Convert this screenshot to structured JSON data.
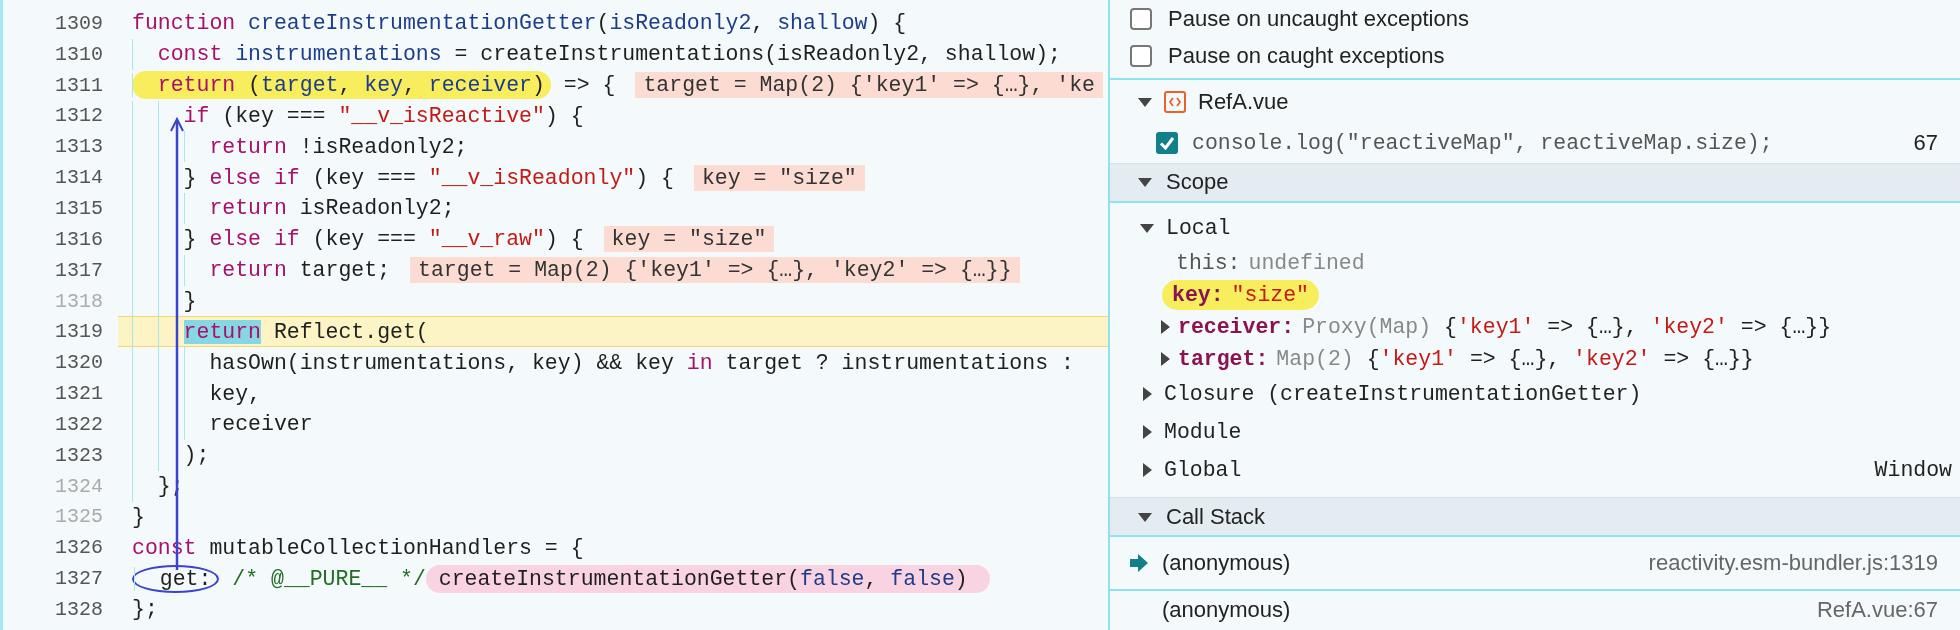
{
  "code_editor": {
    "lines": [
      {
        "number": "1309",
        "faded": false,
        "current": false,
        "tokens": [
          {
            "text": "function",
            "kind": "k"
          },
          {
            "text": " createInstrumentationGetter",
            "kind": "d"
          },
          {
            "text": "(",
            "kind": "p"
          },
          {
            "text": "isReadonly2",
            "kind": "d"
          },
          {
            "text": ", ",
            "kind": "p"
          },
          {
            "text": "shallow",
            "kind": "d"
          },
          {
            "text": ") {",
            "kind": "p"
          }
        ]
      },
      {
        "number": "1310",
        "faded": false,
        "current": false,
        "tokens": [
          {
            "text": "  const",
            "kind": "k"
          },
          {
            "text": " instrumentations",
            "kind": "d"
          },
          {
            "text": " = createInstrumentations(isReadonly2, shallow);",
            "kind": "p"
          }
        ]
      },
      {
        "number": "1311",
        "faded": false,
        "current": false,
        "tokens": [
          {
            "kind": "marker",
            "tokens": [
              {
                "text": "  return",
                "kind": "k"
              },
              {
                "text": " (",
                "kind": "p"
              },
              {
                "text": "target",
                "kind": "d"
              },
              {
                "text": ", ",
                "kind": "p"
              },
              {
                "text": "key",
                "kind": "d"
              },
              {
                "text": ", ",
                "kind": "p"
              },
              {
                "text": "receiver",
                "kind": "d"
              },
              {
                "text": ")",
                "kind": "p"
              }
            ]
          },
          {
            "text": " => {",
            "kind": "p"
          }
        ],
        "inline_values": [
          "target = Map(2) {'key1' => {…}, 'ke"
        ]
      },
      {
        "number": "1312",
        "faded": false,
        "current": false,
        "tokens": [
          {
            "text": "    if",
            "kind": "k"
          },
          {
            "text": " (key === ",
            "kind": "p"
          },
          {
            "text": "\"__v_isReactive\"",
            "kind": "s"
          },
          {
            "text": ") {",
            "kind": "p"
          }
        ]
      },
      {
        "number": "1313",
        "faded": false,
        "current": false,
        "tokens": [
          {
            "text": "      return",
            "kind": "k"
          },
          {
            "text": " !isReadonly2;",
            "kind": "p"
          }
        ]
      },
      {
        "number": "1314",
        "faded": false,
        "current": false,
        "tokens": [
          {
            "text": "    }",
            "kind": "p"
          },
          {
            "text": " else if",
            "kind": "k"
          },
          {
            "text": " (key === ",
            "kind": "p"
          },
          {
            "text": "\"__v_isReadonly\"",
            "kind": "s"
          },
          {
            "text": ") {",
            "kind": "p"
          }
        ],
        "inline_values": [
          "key = \"size\""
        ]
      },
      {
        "number": "1315",
        "faded": false,
        "current": false,
        "tokens": [
          {
            "text": "      return",
            "kind": "k"
          },
          {
            "text": " isReadonly2;",
            "kind": "p"
          }
        ]
      },
      {
        "number": "1316",
        "faded": false,
        "current": false,
        "tokens": [
          {
            "text": "    }",
            "kind": "p"
          },
          {
            "text": " else if",
            "kind": "k"
          },
          {
            "text": " (key === ",
            "kind": "p"
          },
          {
            "text": "\"__v_raw\"",
            "kind": "s"
          },
          {
            "text": ") {",
            "kind": "p"
          }
        ],
        "inline_values": [
          "key = \"size\""
        ]
      },
      {
        "number": "1317",
        "faded": false,
        "current": false,
        "tokens": [
          {
            "text": "      return",
            "kind": "k"
          },
          {
            "text": " target;",
            "kind": "p"
          }
        ],
        "inline_values": [
          "target = Map(2) {'key1' => {…}, 'key2' => {…}}"
        ]
      },
      {
        "number": "1318",
        "faded": true,
        "current": false,
        "tokens": [
          {
            "text": "    }",
            "kind": "p"
          }
        ]
      },
      {
        "number": "1319",
        "faded": false,
        "current": true,
        "tokens": [
          {
            "text": "    return",
            "kind": "x"
          },
          {
            "text": " Reflect.get(",
            "kind": "p"
          }
        ]
      },
      {
        "number": "1320",
        "faded": false,
        "current": false,
        "tokens": [
          {
            "text": "      hasOwn(instrumentations, key) && key",
            "kind": "p"
          },
          {
            "text": " in",
            "kind": "k"
          },
          {
            "text": " target ? instrumentations :",
            "kind": "p"
          }
        ]
      },
      {
        "number": "1321",
        "faded": false,
        "current": false,
        "tokens": [
          {
            "text": "      key,",
            "kind": "p"
          }
        ]
      },
      {
        "number": "1322",
        "faded": false,
        "current": false,
        "tokens": [
          {
            "text": "      receiver",
            "kind": "p"
          }
        ]
      },
      {
        "number": "1323",
        "faded": false,
        "current": false,
        "tokens": [
          {
            "text": "    );",
            "kind": "p"
          }
        ]
      },
      {
        "number": "1324",
        "faded": true,
        "current": false,
        "tokens": [
          {
            "text": "  };",
            "kind": "p"
          }
        ]
      },
      {
        "number": "1325",
        "faded": true,
        "current": false,
        "tokens": [
          {
            "text": "}",
            "kind": "p"
          }
        ]
      },
      {
        "number": "1326",
        "faded": false,
        "current": false,
        "tokens": [
          {
            "text": "const",
            "kind": "k"
          },
          {
            "text": " mutableCollectionHandlers = {",
            "kind": "p"
          }
        ]
      },
      {
        "number": "1327",
        "faded": false,
        "current": false,
        "tokens": [
          {
            "kind": "ring",
            "tokens": [
              {
                "text": "  get:",
                "kind": "p"
              }
            ]
          },
          {
            "text": " /* @__PURE__ */",
            "kind": "c"
          },
          {
            "kind": "pen",
            "tokens": [
              {
                "text": " createInstrumentationGetter(",
                "kind": "p"
              },
              {
                "text": "false",
                "kind": "d"
              },
              {
                "text": ", ",
                "kind": "p"
              },
              {
                "text": "false",
                "kind": "d"
              },
              {
                "text": ")",
                "kind": "p"
              }
            ]
          }
        ]
      },
      {
        "number": "1328",
        "faded": false,
        "current": false,
        "tokens": [
          {
            "text": "};",
            "kind": "p"
          }
        ]
      }
    ]
  },
  "debugger": {
    "exception_options": [
      {
        "label": "Pause on uncaught exceptions",
        "checked": false
      },
      {
        "label": "Pause on caught exceptions",
        "checked": false
      }
    ],
    "breakpoints": [
      {
        "file": "RefA.vue",
        "expanded": true,
        "items": [
          {
            "code": "console.log(\"reactiveMap\", reactiveMap.size);",
            "line": "67",
            "checked": true
          }
        ]
      }
    ],
    "scope": {
      "title": "Scope",
      "expanded": true,
      "scopes": [
        {
          "label": "Local",
          "expanded": true,
          "children": [
            {
              "name": "this:",
              "kind": "special",
              "expandable": false,
              "highlighted": false,
              "tokens": [
                {
                  "text": "undefined",
                  "kind": "g"
                }
              ]
            },
            {
              "name": "key:",
              "kind": "property",
              "expandable": false,
              "highlighted": true,
              "tokens": [
                {
                  "text": "\"size\"",
                  "kind": "s"
                }
              ]
            },
            {
              "name": "receiver:",
              "kind": "property",
              "expandable": true,
              "highlighted": false,
              "tokens": [
                {
                  "text": "Proxy(Map)",
                  "kind": "g"
                },
                {
                  "text": " {",
                  "kind": "p"
                },
                {
                  "text": "'key1'",
                  "kind": "s"
                },
                {
                  "text": " => {…}, ",
                  "kind": "p"
                },
                {
                  "text": "'key2'",
                  "kind": "s"
                },
                {
                  "text": " => {…}}",
                  "kind": "p"
                }
              ]
            },
            {
              "name": "target:",
              "kind": "property",
              "expandable": true,
              "highlighted": false,
              "tokens": [
                {
                  "text": "Map(2)",
                  "kind": "g"
                },
                {
                  "text": " {",
                  "kind": "p"
                },
                {
                  "text": "'key1'",
                  "kind": "s"
                },
                {
                  "text": " => {…}, ",
                  "kind": "p"
                },
                {
                  "text": "'key2'",
                  "kind": "s"
                },
                {
                  "text": " => {…}}",
                  "kind": "p"
                }
              ]
            }
          ]
        },
        {
          "label": "Closure (createInstrumentationGetter)",
          "expanded": false
        },
        {
          "label": "Module",
          "expanded": false
        },
        {
          "label": "Global",
          "expanded": false,
          "value": "Window"
        }
      ]
    },
    "call_stack": {
      "title": "Call Stack",
      "expanded": true,
      "frames": [
        {
          "function": "(anonymous)",
          "location": "reactivity.esm-bundler.js:1319",
          "current": true
        },
        {
          "function": "(anonymous)",
          "location": "RefA.vue:67",
          "current": false
        }
      ]
    }
  }
}
